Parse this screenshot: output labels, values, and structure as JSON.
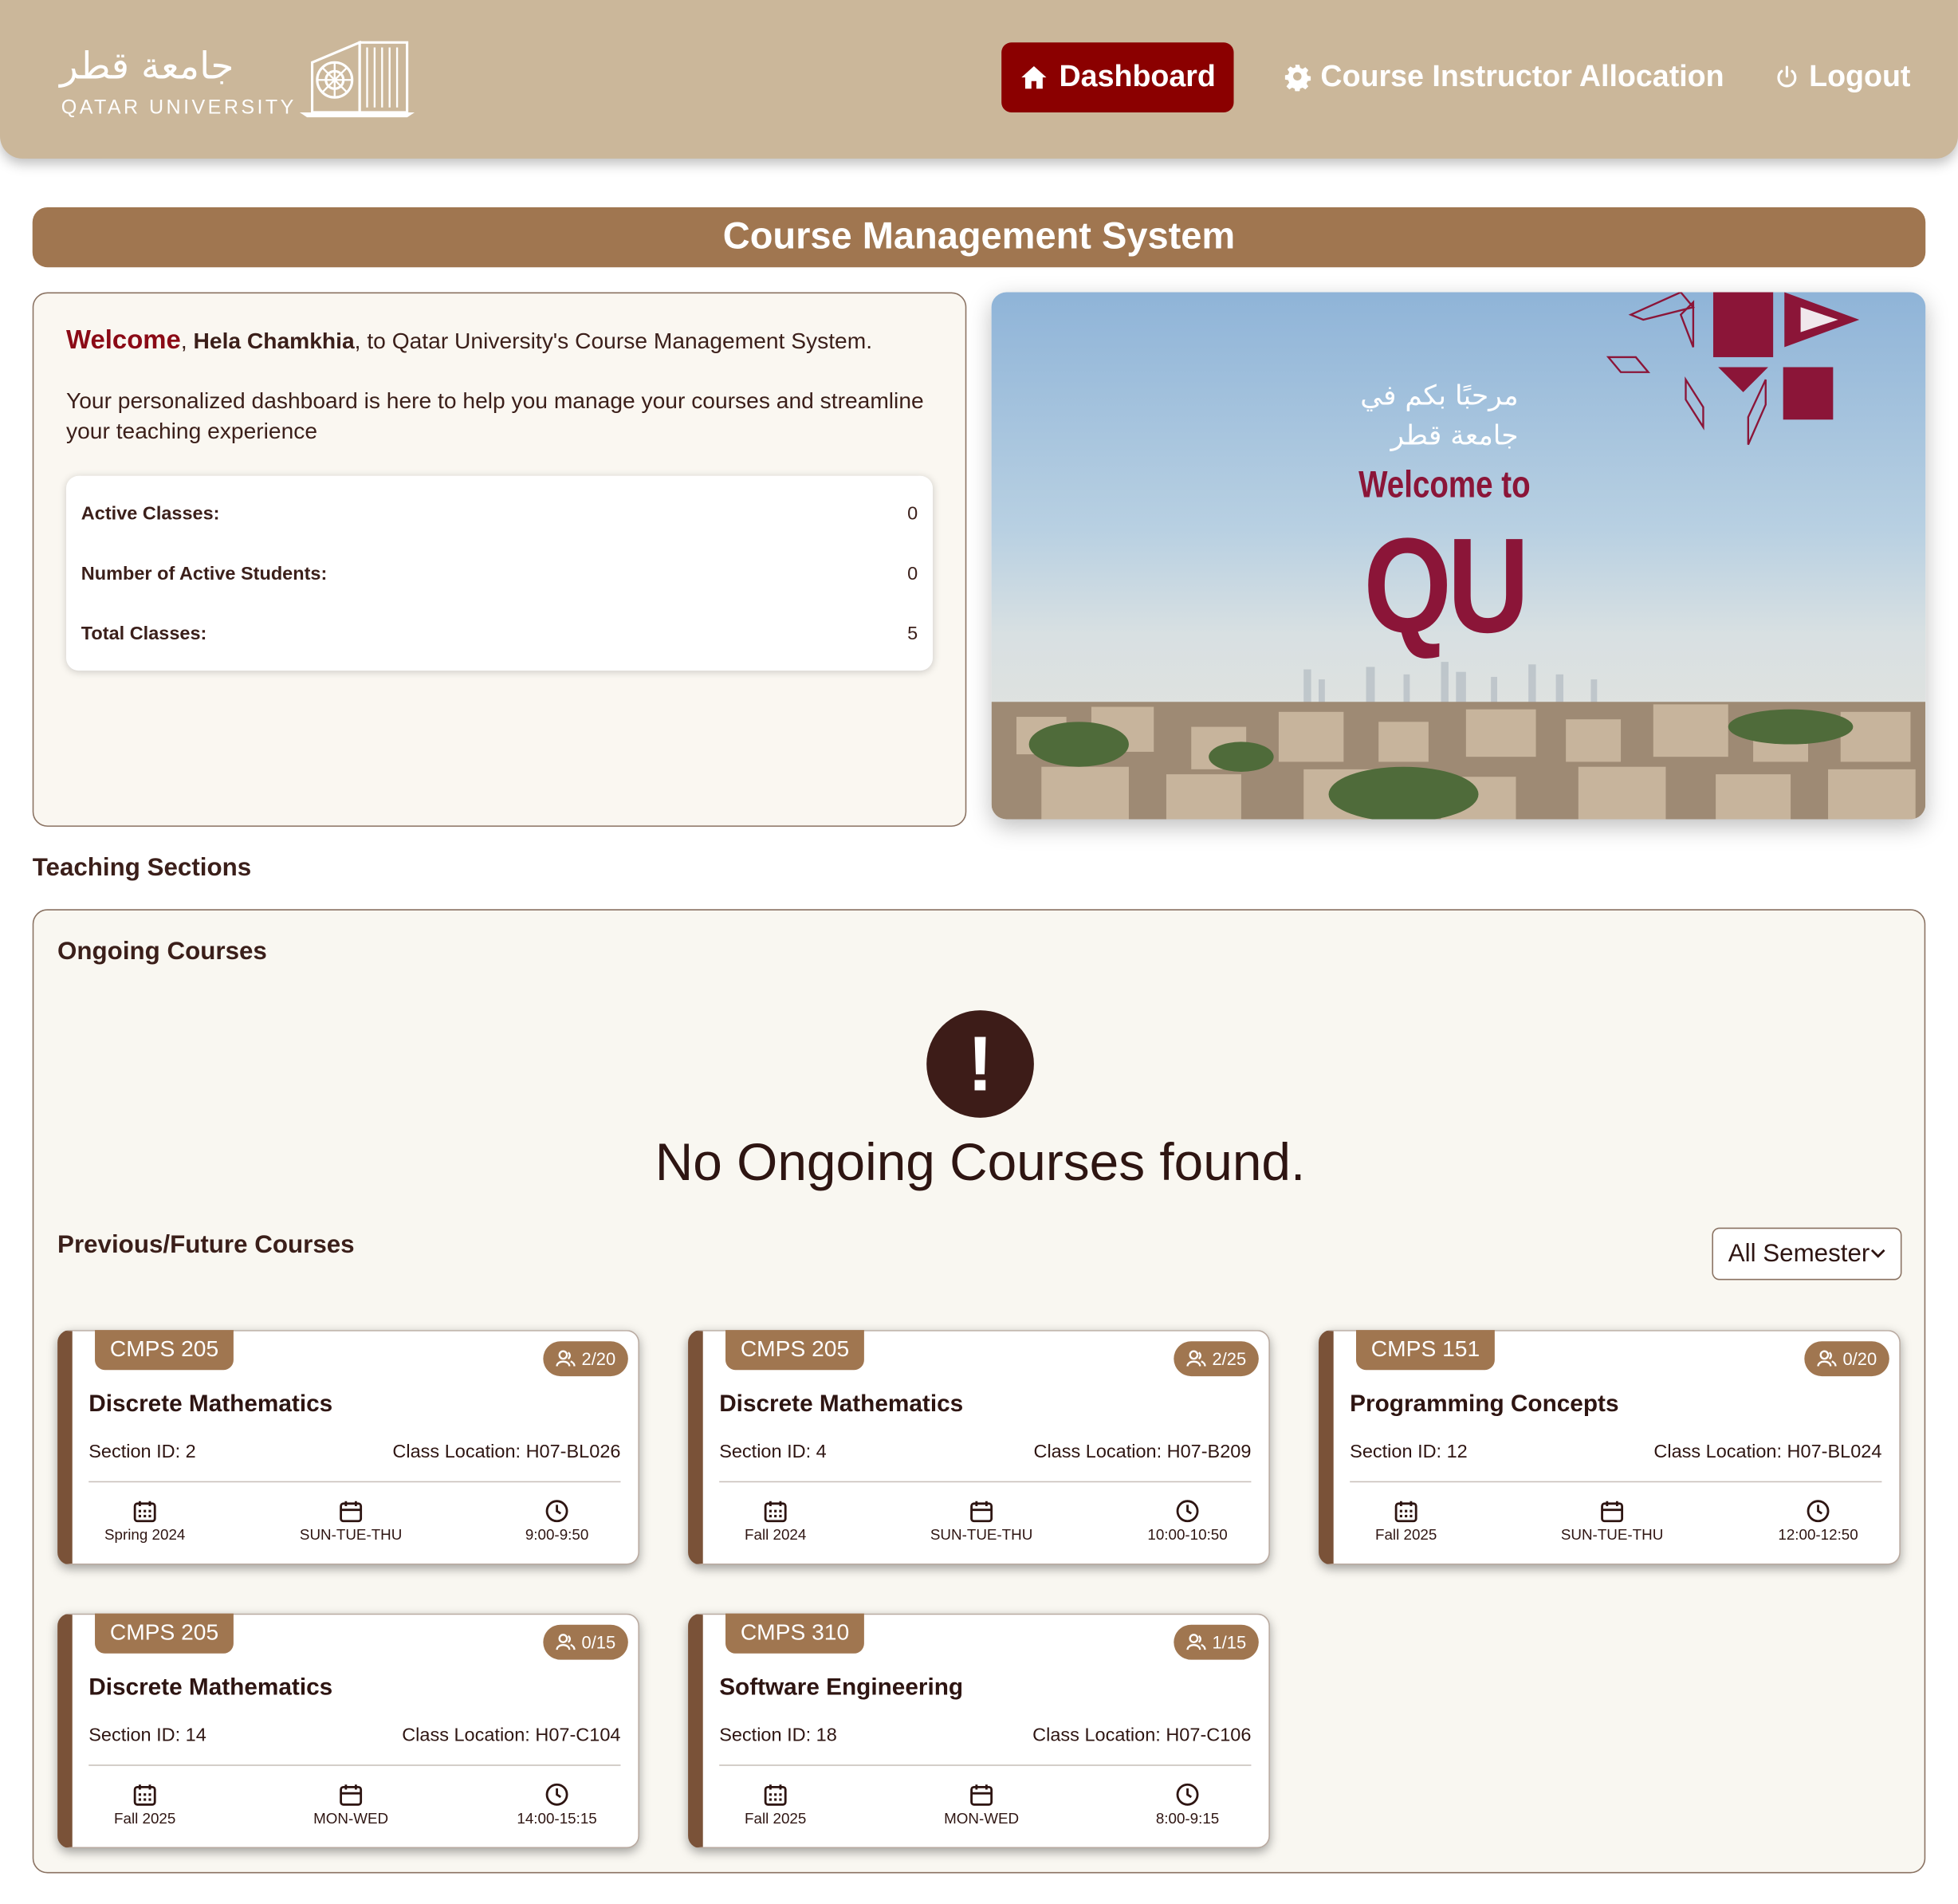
{
  "header": {
    "logo_ar": "جامعة قطر",
    "logo_en": "QATAR UNIVERSITY",
    "nav": [
      {
        "label": "Dashboard",
        "icon": "home-icon"
      },
      {
        "label": "Course Instructor Allocation",
        "icon": "gear-icon"
      },
      {
        "label": "Logout",
        "icon": "power-icon"
      }
    ]
  },
  "title": "Course Management System",
  "welcome": {
    "word": "Welcome",
    "name": "Hela Chamkhia",
    "rest": ", to Qatar University's Course Management System.",
    "description": "Your personalized dashboard is here to help you manage your courses and streamline your teaching experience",
    "stats": [
      {
        "label": "Active Classes:",
        "value": "0"
      },
      {
        "label": "Number of Active Students:",
        "value": "0"
      },
      {
        "label": "Total Classes:",
        "value": "5"
      }
    ]
  },
  "banner": {
    "arabic_line1": "مرحبًا بكم في",
    "arabic_line2": "جامعة قطر",
    "welcome_to": "Welcome to",
    "qu": "QU"
  },
  "teaching_sections_title": "Teaching Sections",
  "ongoing": {
    "title": "Ongoing Courses",
    "empty_icon": "!",
    "empty_message": "No Ongoing Courses found."
  },
  "previous": {
    "title": "Previous/Future Courses",
    "filter_value": "All Semester",
    "courses": [
      {
        "code": "CMPS 205",
        "count": "2/20",
        "name": "Discrete Mathematics",
        "section": "Section ID: 2",
        "location": "Class Location: H07-BL026",
        "semester": "Spring 2024",
        "days": "SUN-TUE-THU",
        "time": "9:00-9:50"
      },
      {
        "code": "CMPS 205",
        "count": "2/25",
        "name": "Discrete Mathematics",
        "section": "Section ID: 4",
        "location": "Class Location: H07-B209",
        "semester": "Fall 2024",
        "days": "SUN-TUE-THU",
        "time": "10:00-10:50"
      },
      {
        "code": "CMPS 151",
        "count": "0/20",
        "name": "Programming Concepts",
        "section": "Section ID: 12",
        "location": "Class Location: H07-BL024",
        "semester": "Fall 2025",
        "days": "SUN-TUE-THU",
        "time": "12:00-12:50"
      },
      {
        "code": "CMPS 205",
        "count": "0/15",
        "name": "Discrete Mathematics",
        "section": "Section ID: 14",
        "location": "Class Location: H07-C104",
        "semester": "Fall 2025",
        "days": "MON-WED",
        "time": "14:00-15:15"
      },
      {
        "code": "CMPS 310",
        "count": "1/15",
        "name": "Software Engineering",
        "section": "Section ID: 18",
        "location": "Class Location: H07-C106",
        "semester": "Fall 2025",
        "days": "MON-WED",
        "time": "8:00-9:15"
      }
    ]
  },
  "colors": {
    "header_bg": "#cbb79a",
    "accent_red": "#8b0000",
    "brown": "#a07650",
    "maroon": "#8b1538"
  }
}
